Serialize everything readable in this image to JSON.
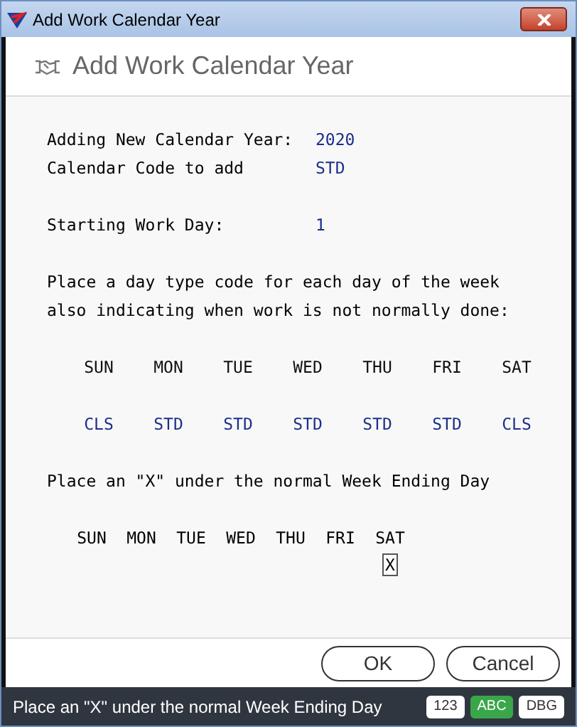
{
  "window": {
    "title": "Add Work Calendar Year"
  },
  "header": {
    "title": "Add Work Calendar Year"
  },
  "fields": [
    {
      "label": "Adding New Calendar Year:",
      "value": "2020"
    },
    {
      "label": "Calendar Code to add",
      "value": "STD"
    },
    {
      "label": "Starting Work Day:",
      "value": "1"
    }
  ],
  "instructions": [
    "Place a day type code for each day of the week",
    "also indicating when work is not normally done:"
  ],
  "day_types": [
    {
      "day": "SUN",
      "code": "CLS"
    },
    {
      "day": "MON",
      "code": "STD"
    },
    {
      "day": "TUE",
      "code": "STD"
    },
    {
      "day": "WED",
      "code": "STD"
    },
    {
      "day": "THU",
      "code": "STD"
    },
    {
      "day": "FRI",
      "code": "STD"
    },
    {
      "day": "SAT",
      "code": "CLS"
    }
  ],
  "week_end_prompt": "Place an \"X\" under the normal Week Ending Day",
  "week_end_days": [
    {
      "day": "SUN"
    },
    {
      "day": "MON"
    },
    {
      "day": "TUE"
    },
    {
      "day": "WED"
    },
    {
      "day": "THU"
    },
    {
      "day": "FRI"
    },
    {
      "day": "SAT",
      "entry": "X"
    }
  ],
  "buttons": [
    "OK",
    "Cancel"
  ],
  "status_bar": {
    "message": "Place an \"X\" under the normal Week Ending Day",
    "indicators": [
      {
        "label": "123",
        "selected": false
      },
      {
        "label": "ABC",
        "selected": true
      },
      {
        "label": "DBG",
        "selected": false
      }
    ]
  }
}
